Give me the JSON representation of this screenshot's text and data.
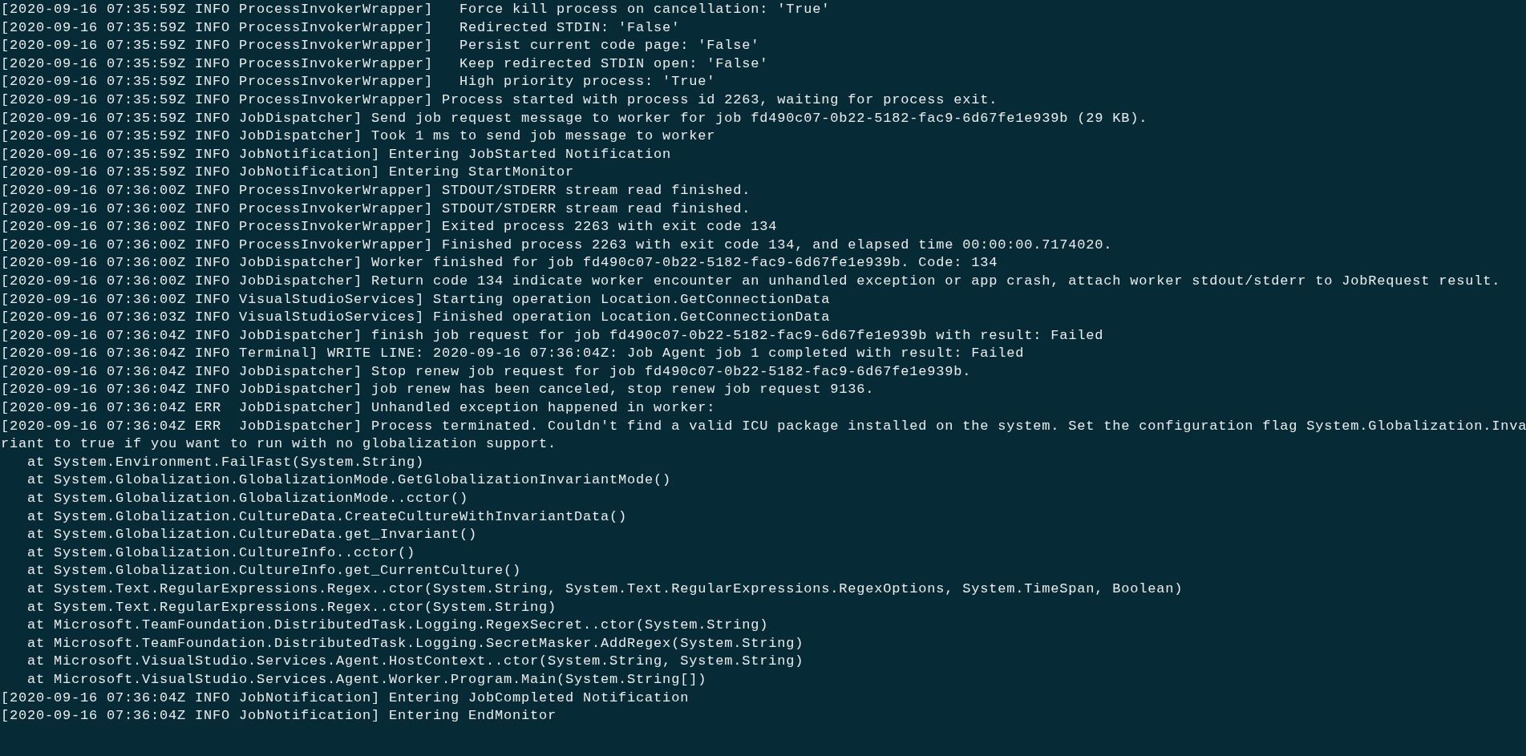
{
  "terminal": {
    "lines": [
      "[2020-09-16 07:35:59Z INFO ProcessInvokerWrapper]   Force kill process on cancellation: 'True'",
      "[2020-09-16 07:35:59Z INFO ProcessInvokerWrapper]   Redirected STDIN: 'False'",
      "[2020-09-16 07:35:59Z INFO ProcessInvokerWrapper]   Persist current code page: 'False'",
      "[2020-09-16 07:35:59Z INFO ProcessInvokerWrapper]   Keep redirected STDIN open: 'False'",
      "[2020-09-16 07:35:59Z INFO ProcessInvokerWrapper]   High priority process: 'True'",
      "[2020-09-16 07:35:59Z INFO ProcessInvokerWrapper] Process started with process id 2263, waiting for process exit.",
      "[2020-09-16 07:35:59Z INFO JobDispatcher] Send job request message to worker for job fd490c07-0b22-5182-fac9-6d67fe1e939b (29 KB).",
      "[2020-09-16 07:35:59Z INFO JobDispatcher] Took 1 ms to send job message to worker",
      "[2020-09-16 07:35:59Z INFO JobNotification] Entering JobStarted Notification",
      "[2020-09-16 07:35:59Z INFO JobNotification] Entering StartMonitor",
      "[2020-09-16 07:36:00Z INFO ProcessInvokerWrapper] STDOUT/STDERR stream read finished.",
      "[2020-09-16 07:36:00Z INFO ProcessInvokerWrapper] STDOUT/STDERR stream read finished.",
      "[2020-09-16 07:36:00Z INFO ProcessInvokerWrapper] Exited process 2263 with exit code 134",
      "[2020-09-16 07:36:00Z INFO ProcessInvokerWrapper] Finished process 2263 with exit code 134, and elapsed time 00:00:00.7174020.",
      "[2020-09-16 07:36:00Z INFO JobDispatcher] Worker finished for job fd490c07-0b22-5182-fac9-6d67fe1e939b. Code: 134",
      "[2020-09-16 07:36:00Z INFO JobDispatcher] Return code 134 indicate worker encounter an unhandled exception or app crash, attach worker stdout/stderr to JobRequest result.",
      "[2020-09-16 07:36:00Z INFO VisualStudioServices] Starting operation Location.GetConnectionData",
      "[2020-09-16 07:36:03Z INFO VisualStudioServices] Finished operation Location.GetConnectionData",
      "[2020-09-16 07:36:04Z INFO JobDispatcher] finish job request for job fd490c07-0b22-5182-fac9-6d67fe1e939b with result: Failed",
      "[2020-09-16 07:36:04Z INFO Terminal] WRITE LINE: 2020-09-16 07:36:04Z: Job Agent job 1 completed with result: Failed",
      "[2020-09-16 07:36:04Z INFO JobDispatcher] Stop renew job request for job fd490c07-0b22-5182-fac9-6d67fe1e939b.",
      "[2020-09-16 07:36:04Z INFO JobDispatcher] job renew has been canceled, stop renew job request 9136.",
      "[2020-09-16 07:36:04Z ERR  JobDispatcher] Unhandled exception happened in worker:",
      "[2020-09-16 07:36:04Z ERR  JobDispatcher] Process terminated. Couldn't find a valid ICU package installed on the system. Set the configuration flag System.Globalization.Inva",
      "riant to true if you want to run with no globalization support.",
      "   at System.Environment.FailFast(System.String)",
      "   at System.Globalization.GlobalizationMode.GetGlobalizationInvariantMode()",
      "   at System.Globalization.GlobalizationMode..cctor()",
      "   at System.Globalization.CultureData.CreateCultureWithInvariantData()",
      "   at System.Globalization.CultureData.get_Invariant()",
      "   at System.Globalization.CultureInfo..cctor()",
      "   at System.Globalization.CultureInfo.get_CurrentCulture()",
      "   at System.Text.RegularExpressions.Regex..ctor(System.String, System.Text.RegularExpressions.RegexOptions, System.TimeSpan, Boolean)",
      "   at System.Text.RegularExpressions.Regex..ctor(System.String)",
      "   at Microsoft.TeamFoundation.DistributedTask.Logging.RegexSecret..ctor(System.String)",
      "   at Microsoft.TeamFoundation.DistributedTask.Logging.SecretMasker.AddRegex(System.String)",
      "   at Microsoft.VisualStudio.Services.Agent.HostContext..ctor(System.String, System.String)",
      "   at Microsoft.VisualStudio.Services.Agent.Worker.Program.Main(System.String[])",
      "[2020-09-16 07:36:04Z INFO JobNotification] Entering JobCompleted Notification",
      "[2020-09-16 07:36:04Z INFO JobNotification] Entering EndMonitor"
    ]
  }
}
